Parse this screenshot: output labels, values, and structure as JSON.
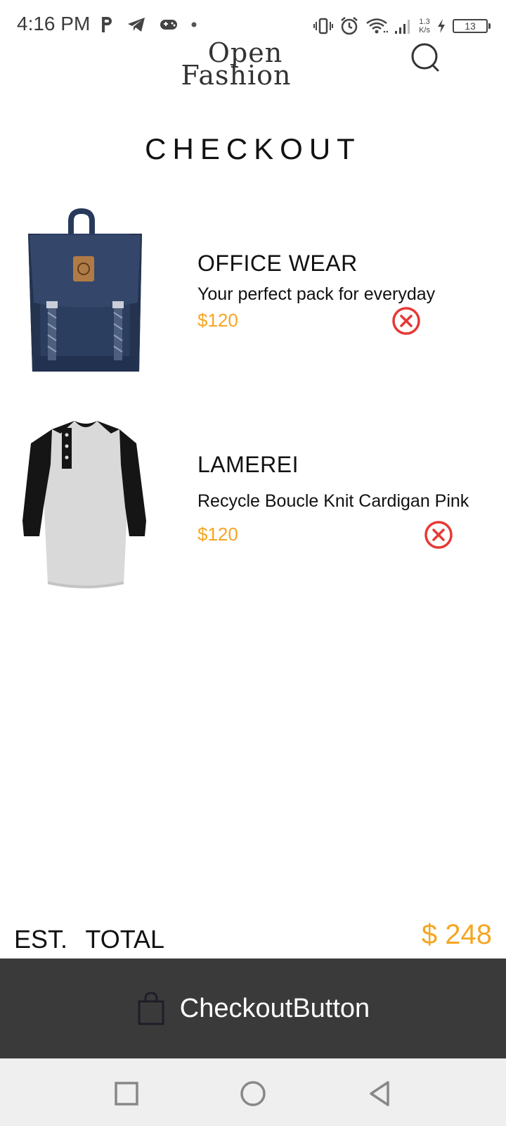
{
  "status_bar": {
    "time": "4:16 PM",
    "net_speed_value": "1.3",
    "net_speed_unit": "K/s",
    "battery": "13"
  },
  "header": {
    "logo_line1": "Open",
    "logo_line2": "Fashion",
    "search_icon": "search-icon"
  },
  "page": {
    "title": "CHECKOUT"
  },
  "cart": {
    "items": [
      {
        "name": "OFFICE WEAR",
        "description": "Your perfect pack for everyday",
        "price": "$120",
        "image": "backpack",
        "remove_icon": "remove-icon"
      },
      {
        "name": "LAMEREI",
        "description": "Recycle Boucle Knit Cardigan Pink",
        "price": "$120",
        "image": "henley-shirt",
        "remove_icon": "remove-icon"
      }
    ]
  },
  "summary": {
    "total_label": "EST. TOTAL",
    "total_value": "$ 248"
  },
  "checkout": {
    "label": "CheckoutButton",
    "icon": "shopping-bag-icon"
  },
  "nav": {
    "recents": "square-icon",
    "home": "circle-icon",
    "back": "triangle-back-icon"
  },
  "colors": {
    "accent": "#f5a623",
    "remove": "#e53935",
    "checkout_bg": "#3a3a3a",
    "nav_bg": "#efefef"
  }
}
